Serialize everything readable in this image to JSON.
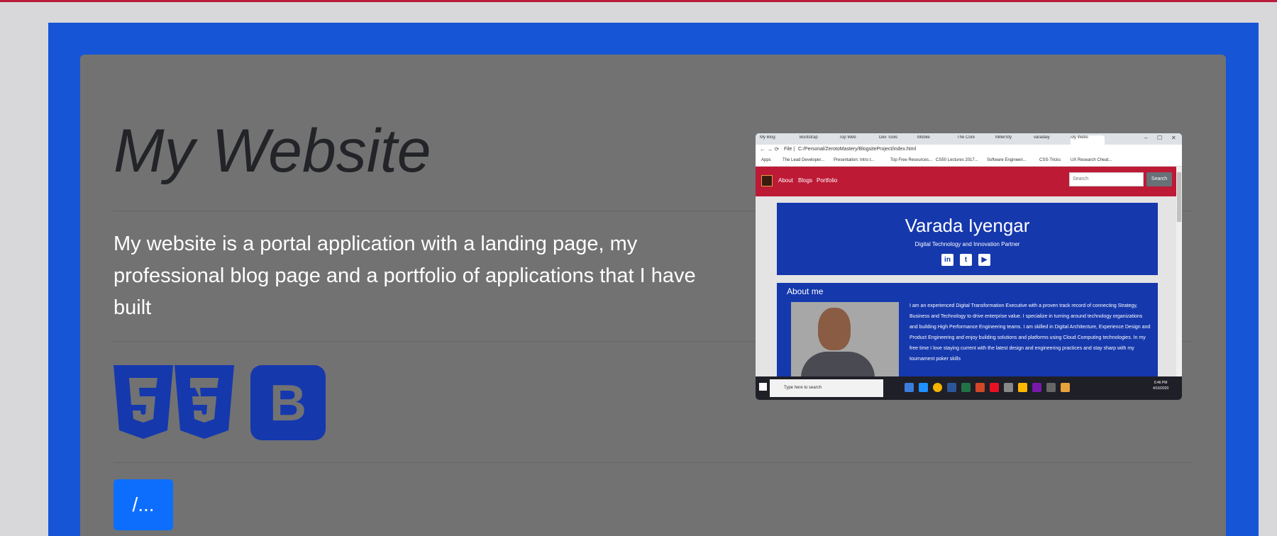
{
  "page": {
    "title": "My Website",
    "description": "My website is a portal application with a landing page, my professional blog page and a portfolio of applications that I have built",
    "tech_icons": [
      "html5-icon",
      "css3-icon",
      "bootstrap-icon"
    ],
    "bootstrap_letter": "B",
    "link_button": "/...",
    "colors": {
      "frame": "#1656d6",
      "card": "#727272",
      "button": "#0d6efd",
      "nav": "#bd1a36",
      "hero": "#1538ad"
    }
  },
  "screenshot": {
    "tabs": [
      "My Blog",
      "Bootstrap",
      "Top Web",
      "Dev Tools",
      "Mobile",
      "The Core",
      "MillerSty",
      "varadaiy",
      "My Webs"
    ],
    "window_controls": [
      "–",
      "☐",
      "✕"
    ],
    "url": "C:/Personal/ZerotoMastery/BlogsiteProject/index.html",
    "url_prefix": "File |",
    "bookmarks": [
      "Apps",
      "The Lead Developer...",
      "Presentation: Intro t...",
      "Top Free Resources...",
      "CS50 Lectures 2017...",
      "Software Engineeri...",
      "CSS-Tricks",
      "UX Research Cheat..."
    ],
    "nav": [
      "About",
      "Blogs",
      "Portfolio"
    ],
    "search_placeholder": "Search",
    "search_button": "Search",
    "hero_name": "Varada Iyengar",
    "hero_subtitle": "Digital Technology and Innovation Partner",
    "social": [
      "in",
      "t",
      "▶"
    ],
    "about_heading": "About me",
    "about_text": "I am an experienced Digital Transformation Executive with a proven track record of connecting Strategy, Business and Technology to drive enterprise value. I specialize in turning around technology organizations and building High Performance Engineering teams. I am skilled in Digital Architecture, Experience Design and Product Engineering and enjoy building solutions and platforms using Cloud Computing technologies. In my free time I love staying current with the latest design and engineering practices and stay sharp with my tournament poker skills",
    "taskbar_search": "Type here to search",
    "clock_time": "6:46 PM",
    "clock_date": "4/16/2020"
  }
}
